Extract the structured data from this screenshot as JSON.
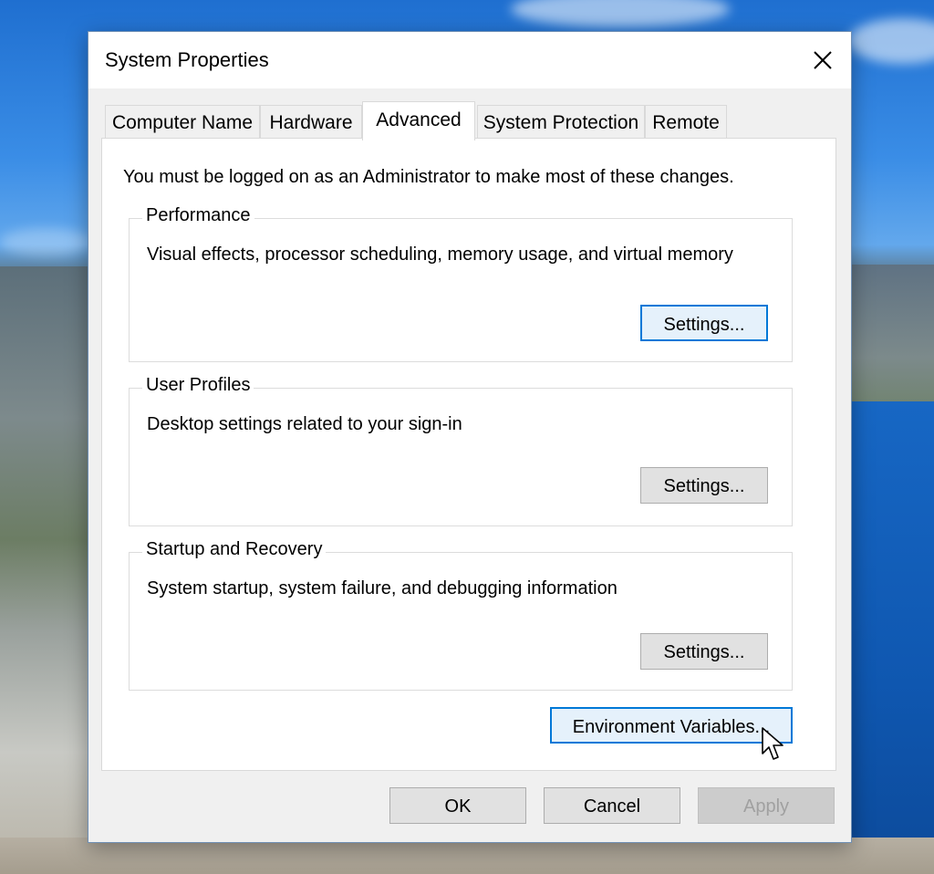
{
  "window": {
    "title": "System Properties"
  },
  "tabs": [
    {
      "label": "Computer Name",
      "active": false
    },
    {
      "label": "Hardware",
      "active": false
    },
    {
      "label": "Advanced",
      "active": true
    },
    {
      "label": "System Protection",
      "active": false
    },
    {
      "label": "Remote",
      "active": false
    }
  ],
  "panel": {
    "admin_note": "You must be logged on as an Administrator to make most of these changes."
  },
  "groups": {
    "performance": {
      "label": "Performance",
      "description": "Visual effects, processor scheduling, memory usage, and virtual memory",
      "button": "Settings..."
    },
    "user_profiles": {
      "label": "User Profiles",
      "description": "Desktop settings related to your sign-in",
      "button": "Settings..."
    },
    "startup_recovery": {
      "label": "Startup and Recovery",
      "description": "System startup, system failure, and debugging information",
      "button": "Settings..."
    }
  },
  "env_button": "Environment Variables...",
  "footer": {
    "ok": "OK",
    "cancel": "Cancel",
    "apply": "Apply"
  },
  "icons": {
    "close": "close-icon",
    "cursor": "mouse-pointer-icon"
  },
  "colors": {
    "accent": "#0078d7",
    "dialog_bg": "#f0f0f0",
    "panel_bg": "#ffffff"
  }
}
